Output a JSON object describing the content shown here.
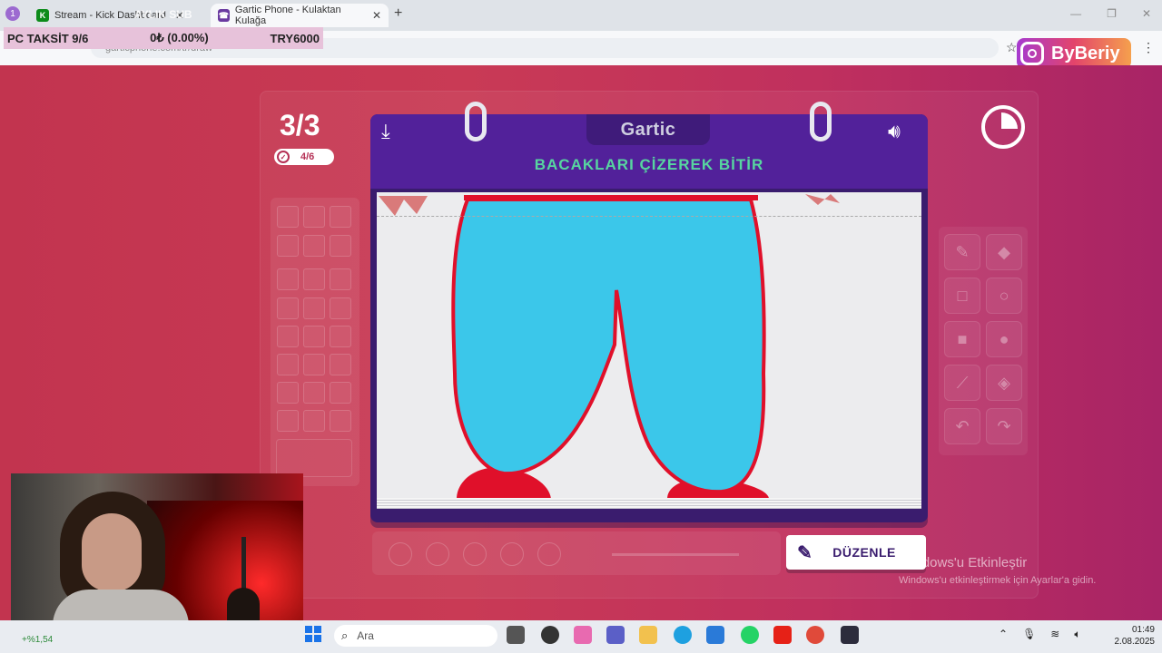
{
  "browser": {
    "tab_group_label": "1",
    "tabs": [
      {
        "title": "Stream - Kick Dashboard",
        "favicon": "kick-icon"
      },
      {
        "title": "Gartic Phone - Kulaktan Kulağa",
        "favicon": "gartic-icon"
      }
    ],
    "url": "garticphone.com/tr/draw"
  },
  "overlay": {
    "aylik_label": "AYLIK SUB",
    "taksit": {
      "label": "PC TAKSİT 9/6",
      "amount": "0₺ (0.00%)",
      "goal": "TRY6000"
    },
    "social": {
      "handle": "ByBeriy",
      "icon": "instagram-icon"
    }
  },
  "game": {
    "round": "3/3",
    "done_count": "4/6",
    "logo": "Gartic",
    "task": "BACAKLARI ÇİZEREK BİTİR",
    "edit_button": "DÜZENLE"
  },
  "windows": {
    "activate_title": "Windows'u Etkinleştir",
    "activate_sub": "Windows'u etkinleştirmek için Ayarlar'a gidin."
  },
  "taskbar": {
    "search_placeholder": "Ara",
    "stock": "+%1,54",
    "time": "01:49",
    "date": "2.08.2025"
  },
  "colors": {
    "stage": "#c2344f",
    "book": "#52219a",
    "task_text": "#57d6a0",
    "pants": "#3bc7ea",
    "outline": "#e0102a"
  }
}
